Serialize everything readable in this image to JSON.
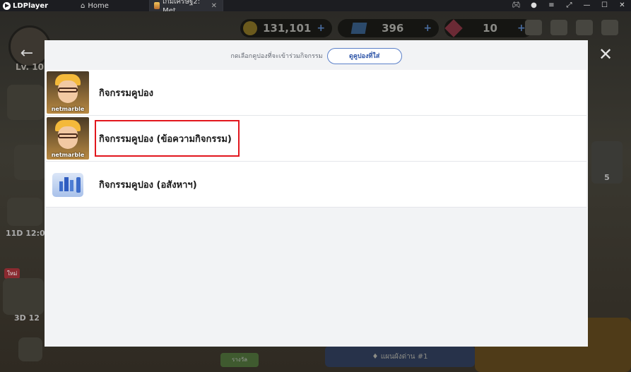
{
  "titlebar": {
    "app_name": "LDPlayer",
    "tabs": [
      {
        "label": "Home"
      },
      {
        "label": "เกมเศรษฐี2: Met...",
        "close": "✕"
      }
    ],
    "window_controls": [
      "gamepad-icon",
      "user-icon",
      "menu-icon",
      "pin-icon",
      "minimize-icon",
      "maximize-icon",
      "close-icon"
    ]
  },
  "game": {
    "resources": [
      {
        "value": "131,101"
      },
      {
        "value": "396"
      },
      {
        "value": "10"
      }
    ],
    "level_label": "Lv. 10",
    "timer_1": "11D 12:0",
    "new_badge": "ใหม่",
    "timer_2": "3D 12",
    "right_badge_count": "5",
    "bottom_banner": "♦ แผนผังด่าน #1",
    "bottom_tab_label": "รางวัล"
  },
  "dialog": {
    "prompt": "กดเลือกคูปองที่จะเข้าร่วมกิจกรรม",
    "view_button": "ดูคูปองที่ใส่",
    "items": [
      {
        "label": "กิจกรรมคูปอง",
        "thumb_text": "netmarble"
      },
      {
        "label": "กิจกรรมคูปอง (ข้อความกิจกรรม)",
        "thumb_text": "netmarble"
      },
      {
        "label": "กิจกรรมคูปอง (อสังหาฯ)",
        "thumb_text": ""
      }
    ]
  },
  "colors": {
    "highlight": "#e2161d",
    "button_border": "#5b80c9",
    "button_text": "#2e55a8"
  }
}
